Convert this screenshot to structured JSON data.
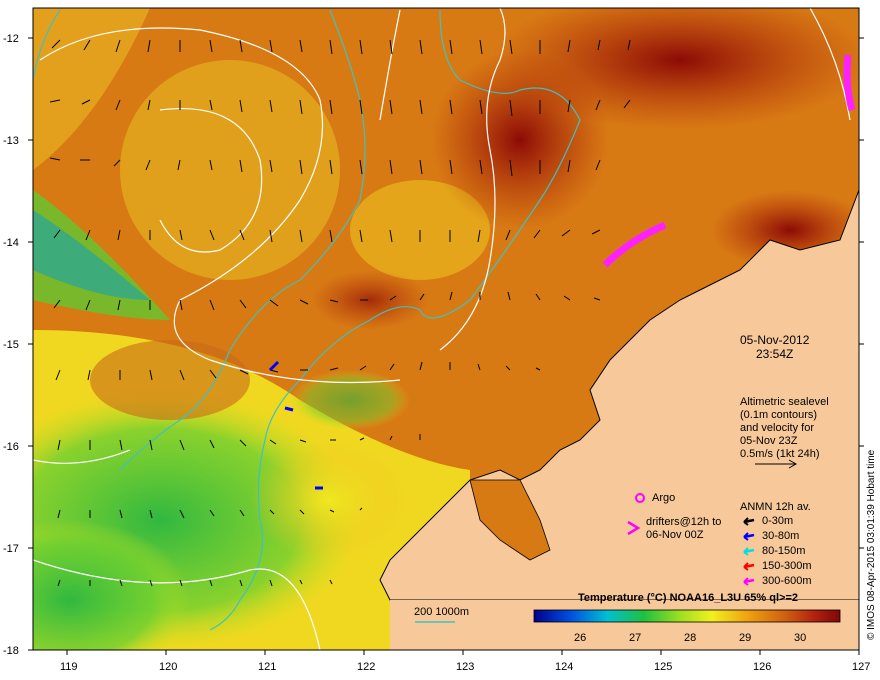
{
  "map": {
    "lon_ticks": [
      "119",
      "120",
      "121",
      "122",
      "123",
      "124",
      "125",
      "126",
      "127"
    ],
    "lat_ticks": [
      "-12",
      "-13",
      "-14",
      "-15",
      "-16",
      "-17",
      "-18"
    ],
    "lon_range": [
      118.6,
      127.0
    ],
    "lat_range": [
      -18.0,
      -11.7
    ]
  },
  "date": {
    "day": "05-Nov-2012",
    "time": "23:54Z"
  },
  "sealevel_note": [
    "Altimetric sealevel",
    "(0.1m contours)",
    "and velocity for",
    "05-Nov 23Z",
    "0.5m/s (1kt 24h)"
  ],
  "legend": {
    "argo": "Argo",
    "drifters": [
      "drifters@12h to",
      "06-Nov 00Z"
    ],
    "anmn_title": "ANMN 12h av.",
    "anmn_items": [
      {
        "label": "0-30m",
        "color": "#000000"
      },
      {
        "label": "30-80m",
        "color": "#0000ff"
      },
      {
        "label": "80-150m",
        "color": "#00e0e0"
      },
      {
        "label": "150-300m",
        "color": "#ff0000"
      },
      {
        "label": "300-600m",
        "color": "#ff00ff"
      }
    ],
    "isobath": "200  1000m"
  },
  "colorbar": {
    "title": "Temperature (°C) NOAA16_L3U 65% ql>=2",
    "ticks": [
      "26",
      "27",
      "28",
      "29",
      "30"
    ]
  },
  "credit": "© IMOS 08-Apr-2015 03:01:39 Hobart time",
  "colors": {
    "land": "#f7c99a",
    "warm": "#d07010",
    "hot": "#9a1008",
    "cool": "#e8e020",
    "green": "#40c040",
    "contour": "#ffffff",
    "isobath": "#40c0c0"
  }
}
